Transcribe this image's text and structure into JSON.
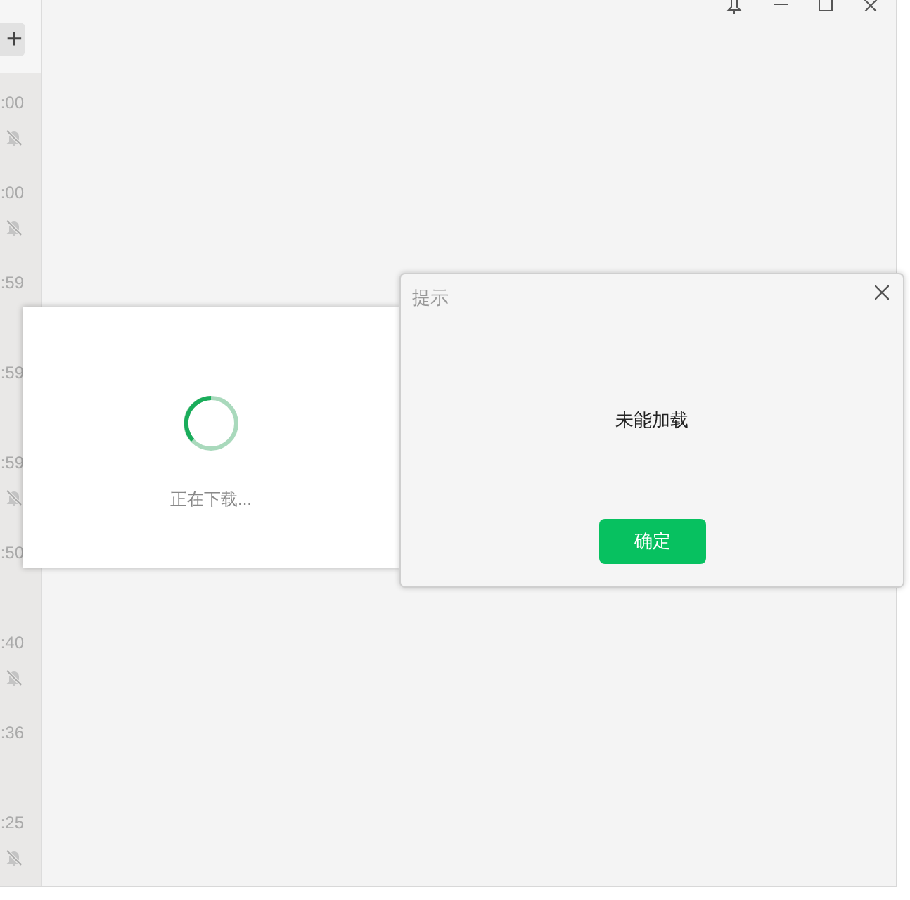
{
  "sidebar": {
    "add_button": "+",
    "chats": [
      {
        "time": ":00",
        "muted": true
      },
      {
        "time": ":00",
        "muted": true
      },
      {
        "time": ":59",
        "muted": false
      },
      {
        "time": ":59",
        "muted": false
      },
      {
        "time": ":59",
        "muted": true
      },
      {
        "time": ":50",
        "muted": false
      },
      {
        "time": ":40",
        "muted": true
      },
      {
        "time": ":36",
        "muted": false
      },
      {
        "time": ":25",
        "muted": true
      }
    ]
  },
  "loading_dialog": {
    "message": "正在下载..."
  },
  "alert_dialog": {
    "title": "提示",
    "message": "未能加载",
    "confirm_button": "确定"
  }
}
